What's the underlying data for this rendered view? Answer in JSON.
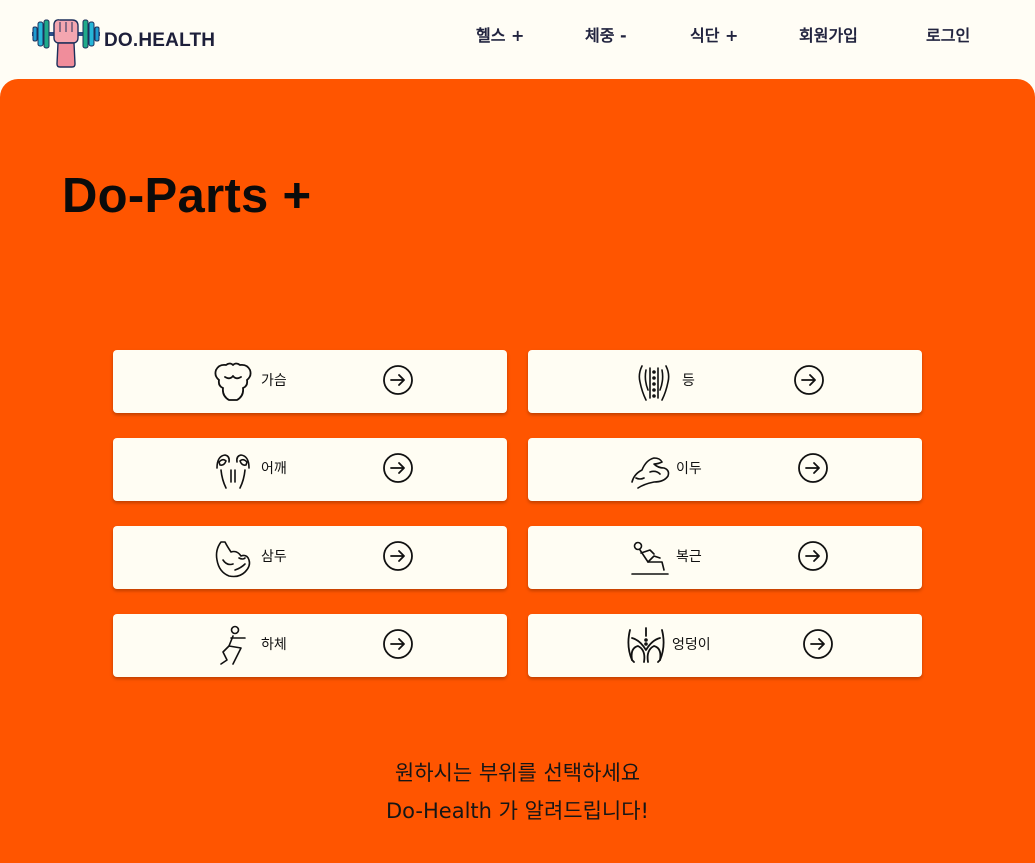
{
  "header": {
    "brand": "DO.HEALTH",
    "logo_icon": "dumbbell-hand-icon",
    "nav": [
      {
        "label": "헬스 +",
        "name": "nav-health"
      },
      {
        "label": "체중 -",
        "name": "nav-weight"
      },
      {
        "label": "식단 +",
        "name": "nav-diet"
      },
      {
        "label": "회원가입",
        "name": "nav-signup"
      },
      {
        "label": "로그인",
        "name": "nav-login"
      }
    ]
  },
  "main": {
    "title": "Do-Parts +",
    "parts": [
      {
        "label": "가슴",
        "icon": "chest-icon"
      },
      {
        "label": "등",
        "icon": "back-icon"
      },
      {
        "label": "어깨",
        "icon": "shoulder-icon"
      },
      {
        "label": "이두",
        "icon": "biceps-icon"
      },
      {
        "label": "삼두",
        "icon": "triceps-icon"
      },
      {
        "label": "복근",
        "icon": "abs-situp-icon"
      },
      {
        "label": "하체",
        "icon": "legs-squat-icon"
      },
      {
        "label": "엉덩이",
        "icon": "glutes-icon"
      }
    ],
    "arrow_icon": "arrow-right-circle-icon",
    "footer_line1": "원하시는 부위를 선택하세요",
    "footer_line2": "Do-Health 가 알려드립니다!"
  },
  "colors": {
    "accent": "#ff5500",
    "background": "#fffdf5",
    "card": "#fffdf3",
    "text_dark": "#22243f"
  }
}
